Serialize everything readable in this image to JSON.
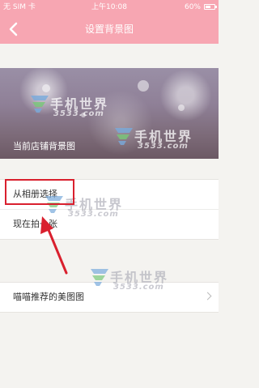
{
  "status_bar": {
    "carrier": "无 SIM 卡",
    "time": "上午10:08",
    "battery": "60%",
    "battery_level": 0.6
  },
  "nav": {
    "title": "设置背景图",
    "back_icon": "chevron-left-icon"
  },
  "background": {
    "caption": "当前店铺背景图"
  },
  "options": {
    "album": "从相册选择",
    "camera": "现在拍一张"
  },
  "recommend": {
    "label": "喵喵推荐的美图图"
  },
  "watermark": {
    "name": "手机世界",
    "number": "3533.com"
  },
  "colors": {
    "accent": "#f7a6b2",
    "highlight": "#d9202e",
    "background": "#f4f3f0"
  }
}
